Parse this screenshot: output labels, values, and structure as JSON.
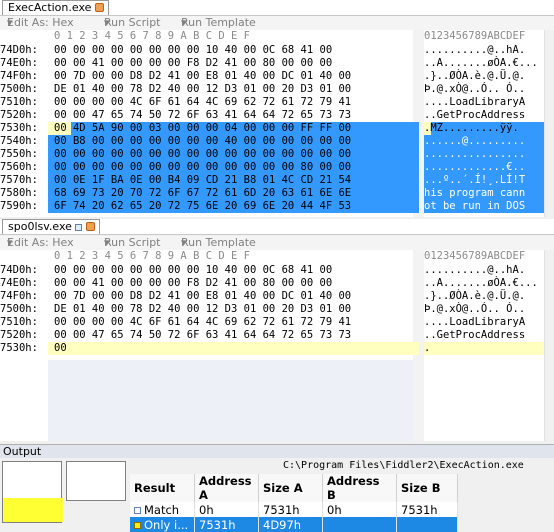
{
  "colors": {
    "selection": "#3399ff",
    "highlight": "#ffffc0",
    "thumb_band": "#ffff33"
  },
  "top": {
    "tab_label": "ExecAction.exe",
    "toolbar": {
      "edit_as": "Edit As: Hex",
      "run_script": "Run Script",
      "run_template": "Run Template"
    },
    "hex_header": "0  1  2  3  4  5  6  7  8  9  A  B  C  D  E  F",
    "ascii_header": "0123456789ABCDEF",
    "rows": [
      {
        "offset": "74D0h:",
        "hex": "00 00 00 00 00 00 00 00 10 40 00 0C 68 41 00",
        "ascii": "..........@..hA."
      },
      {
        "offset": "74E0h:",
        "hex": "00 00 41 00 00 00 00 F8 D2 41 00 80 00 00 00",
        "ascii": "..A.......øÒA.€..."
      },
      {
        "offset": "74F0h:",
        "hex": "00 7D 00 00 D8 D2 41 00 E8 01 40 00 DC 01 40 00",
        "ascii": ".}..ØÒA.è.@.Ü.@."
      },
      {
        "offset": "7500h:",
        "hex": "DE 01 40 00 78 D2 40 00 12 D3 01 00 20 D3 01 00",
        "ascii": "Þ.@.xÒ@..Ó.. Ó.."
      },
      {
        "offset": "7510h:",
        "hex": "00 00 00 00 4C 6F 61 64 4C 69 62 72 61 72 79 41",
        "ascii": "....LoadLibraryA"
      },
      {
        "offset": "7520h:",
        "hex": "00 00 47 65 74 50 72 6F 63 41 64 64 72 65 73 73",
        "ascii": "..GetProcAddress"
      },
      {
        "offset": "7530h:",
        "hex": "00 4D 5A 90 00 03 00 00 00 04 00 00 00 FF FF 00",
        "ascii": ".MZ.........ÿÿ."
      },
      {
        "offset": "7540h:",
        "hex": "00 B8 00 00 00 00 00 00 00 40 00 00 00 00 00 00",
        "ascii": "......@........."
      },
      {
        "offset": "7550h:",
        "hex": "00 00 00 00 00 00 00 00 00 00 00 00 00 00 00 00",
        "ascii": "................"
      },
      {
        "offset": "7560h:",
        "hex": "00 00 00 00 00 00 00 00 00 00 00 00 00 80 00 00",
        "ascii": ".............€.."
      },
      {
        "offset": "7570h:",
        "hex": "00 0E 1F BA 0E 00 B4 09 CD 21 B8 01 4C CD 21 54",
        "ascii": "...º..´.Í!¸.LÍ!T"
      },
      {
        "offset": "7580h:",
        "hex": "68 69 73 20 70 72 6F 67 72 61 6D 20 63 61 6E 6E",
        "ascii": "his program cann"
      },
      {
        "offset": "7590h:",
        "hex": "6F 74 20 62 65 20 72 75 6E 20 69 6E 20 44 4F 53",
        "ascii": "ot be run in DOS"
      }
    ]
  },
  "bottom": {
    "tab_label": "spo0lsv.exe",
    "toolbar": {
      "edit_as": "Edit As: Hex",
      "run_script": "Run Script",
      "run_template": "Run Template"
    },
    "hex_header": "0  1  2  3  4  5  6  7  8  9  A  B  C  D  E  F",
    "ascii_header": "0123456789ABCDEF",
    "rows": [
      {
        "offset": "74D0h:",
        "hex": "00 00 00 00 00 00 00 00 10 40 00 0C 68 41 00",
        "ascii": "..........@..hA."
      },
      {
        "offset": "74E0h:",
        "hex": "00 00 41 00 00 00 00 F8 D2 41 00 80 00 00 00",
        "ascii": "..A.......øÒA.€..."
      },
      {
        "offset": "74F0h:",
        "hex": "00 7D 00 00 D8 D2 41 00 E8 01 40 00 DC 01 40 00",
        "ascii": ".}..ØÒA.è.@.Ü.@."
      },
      {
        "offset": "7500h:",
        "hex": "DE 01 40 00 78 D2 40 00 12 D3 01 00 20 D3 01 00",
        "ascii": "Þ.@.xÒ@..Ó.. Ó.."
      },
      {
        "offset": "7510h:",
        "hex": "00 00 00 00 4C 6F 61 64 4C 69 62 72 61 72 79 41",
        "ascii": "....LoadLibraryA"
      },
      {
        "offset": "7520h:",
        "hex": "00 00 47 65 74 50 72 6F 63 41 64 64 72 65 73 73",
        "ascii": "..GetProcAddress"
      },
      {
        "offset": "7530h:",
        "hex": "00",
        "ascii": "."
      }
    ]
  },
  "output": {
    "title": "Output",
    "path": "C:\\Program Files\\Fiddler2\\ExecAction.exe",
    "columns": [
      "Result",
      "Address A",
      "Size A",
      "Address B",
      "Size B"
    ],
    "rows": [
      {
        "cells": [
          "Match",
          "0h",
          "7531h",
          "0h",
          "7531h"
        ]
      },
      {
        "cells": [
          "Only i...",
          "7531h",
          "4D97h",
          "",
          ""
        ]
      }
    ]
  }
}
